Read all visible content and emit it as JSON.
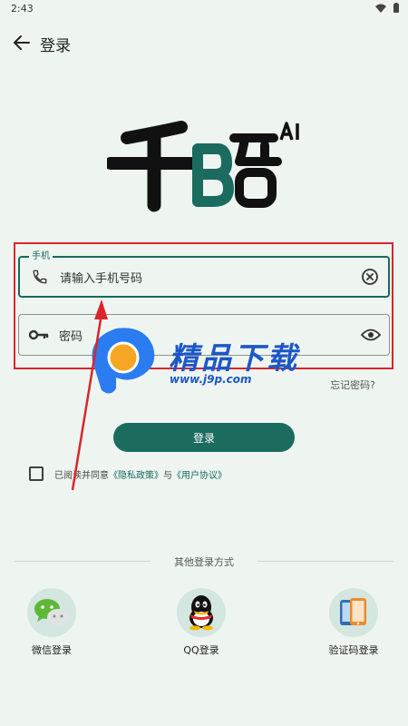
{
  "status_bar": {
    "time": "2:43"
  },
  "app_bar": {
    "title": "登录"
  },
  "form": {
    "phone": {
      "label": "手机",
      "placeholder": "请输入手机号码"
    },
    "password": {
      "placeholder": "密码"
    },
    "forgot_password": "忘记密码?"
  },
  "login_button": "登录",
  "agreement": {
    "prefix": "已阅读并同意",
    "privacy": "《隐私政策》",
    "connector": "与",
    "terms": "《用户协议》"
  },
  "other_login": {
    "title": "其他登录方式",
    "options": [
      {
        "label": "微信登录",
        "icon": "wechat-icon"
      },
      {
        "label": "QQ登录",
        "icon": "qq-icon"
      },
      {
        "label": "验证码登录",
        "icon": "sms-phone-icon"
      }
    ]
  },
  "watermark": {
    "title": "精品下载",
    "url": "www.j9p.com"
  },
  "colors": {
    "primary": "#1b6b5f",
    "background": "#eef5f1",
    "annotation": "#d9262b",
    "watermark": "#1c57c7"
  }
}
